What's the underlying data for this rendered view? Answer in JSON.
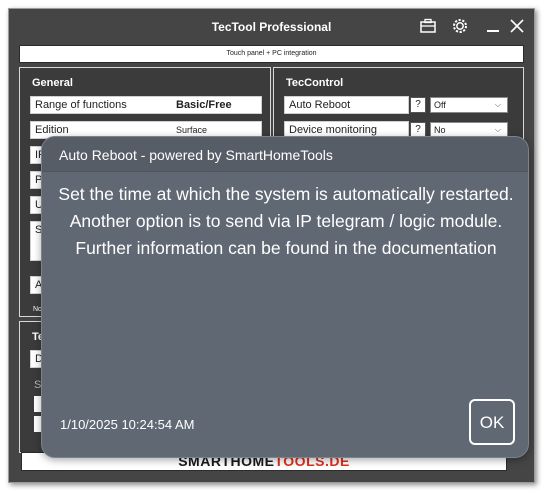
{
  "window": {
    "title": "TecTool Professional",
    "subtitle": "Touch panel + PC integration"
  },
  "icons": [
    "toolbox-icon",
    "gear-icon",
    "minimize-icon",
    "close-icon",
    "chevron-down-icon"
  ],
  "general": {
    "title": "General",
    "rows": [
      {
        "label": "Range of functions",
        "value": "Basic/Free"
      },
      {
        "label": "Edition",
        "value": "Surface"
      }
    ],
    "partial_labels": [
      "IP",
      "Po",
      "U",
      "Sy",
      "A",
      "No"
    ]
  },
  "teccontrol": {
    "title": "TecControl",
    "rows": [
      {
        "label": "Auto Reboot",
        "help": "?",
        "option": "Off"
      },
      {
        "label": "Device monitoring",
        "help": "?",
        "option": "No"
      }
    ]
  },
  "lower_panel": {
    "partial_labels": [
      "Te",
      "D",
      "Sl"
    ]
  },
  "footer": {
    "brand_part1": "SMARTHOME",
    "brand_part2": "TOOLS.DE"
  },
  "dialog": {
    "title": "Auto Reboot - powered by SmartHomeTools",
    "message": "Set the time at which the system is automatically restarted. Another option is to send via IP telegram / logic module. Further information can be found in the documentation",
    "timestamp": "1/10/2025 10:24:54 AM",
    "ok_label": "OK"
  },
  "colors": {
    "window_bg": "#454545",
    "panel_bg": "#3b3b3b",
    "dialog_bg": "#606873",
    "brand_red": "#e0301e"
  }
}
